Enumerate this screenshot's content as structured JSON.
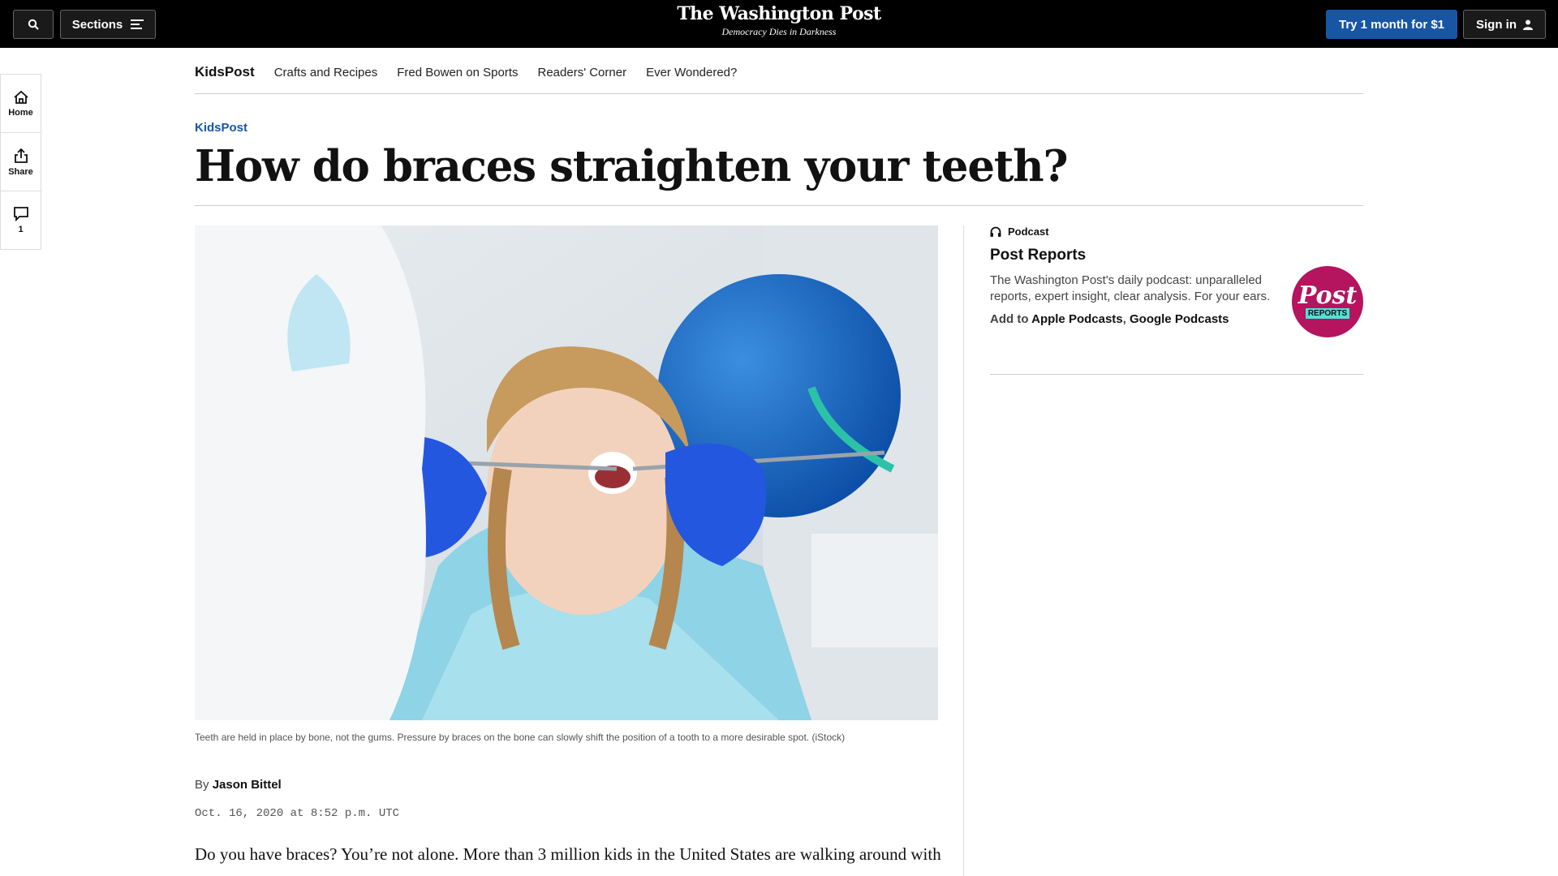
{
  "topbar": {
    "sections_label": "Sections",
    "logo_title": "The Washington Post",
    "logo_tagline": "Democracy Dies in Darkness",
    "subscribe_label": "Try 1 month for $1",
    "signin_label": "Sign in"
  },
  "rail": {
    "home_label": "Home",
    "share_label": "Share",
    "comments_count": "1"
  },
  "subnav": {
    "brand": "KidsPost",
    "links": [
      "Crafts and Recipes",
      "Fred Bowen on Sports",
      "Readers' Corner",
      "Ever Wondered?"
    ]
  },
  "article": {
    "kicker": "KidsPost",
    "headline": "How do braces straighten your teeth?",
    "caption": "Teeth are held in place by bone, not the gums. Pressure by braces on the bone can slowly shift the position of a tooth to a more desirable spot. (iStock)",
    "byline_prefix": "By",
    "author": "Jason Bittel",
    "date": "Oct. 16, 2020 at 8:52 p.m. UTC",
    "lede": "Do you have braces? You’re not alone. More than 3 million kids in the United States are walking around with"
  },
  "podcast": {
    "label": "Podcast",
    "title": "Post Reports",
    "description": "The Washington Post's daily podcast: unparalleled reports, expert insight, clear analysis. For your ears.",
    "add_to": "Add to",
    "apple": "Apple Podcasts",
    "separator": ",",
    "google": "Google Podcasts",
    "logo_word": "Post",
    "logo_sub": "REPORTS"
  }
}
